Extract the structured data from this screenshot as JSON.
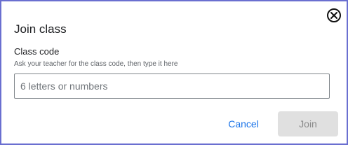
{
  "dialog": {
    "title": "Join class",
    "field_label": "Class code",
    "field_hint": "Ask your teacher for the class code, then type it here",
    "input": {
      "value": "",
      "placeholder": "6 letters or numbers"
    },
    "cancel_label": "Cancel",
    "join_label": "Join",
    "join_enabled": false,
    "close_icon": "close-circle-icon"
  },
  "colors": {
    "border": "#6a6fd0",
    "cancel_text": "#1a73e8",
    "join_disabled_bg": "#e0e0e0",
    "join_disabled_text": "#8a8a8a"
  }
}
